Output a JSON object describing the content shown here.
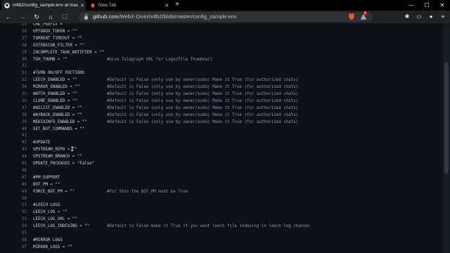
{
  "tabs": [
    {
      "title": "mltb2/config_sample.env at mas"
    },
    {
      "title": "New Tab"
    }
  ],
  "toolbar": {
    "url_host": "github.com",
    "url_path": "/WebX-Divin/mltb2/blob/master/config_sample.env",
    "badge_count": "4"
  },
  "icons": {
    "back": "back-arrow-icon",
    "forward": "forward-arrow-icon",
    "reload": "reload-icon",
    "home": "home-icon",
    "lock": "lock-icon",
    "brave": "brave-shield-icon",
    "rewards": "brave-rewards-icon",
    "extensions": "puzzle-icon",
    "profile": "profile-icon",
    "menu": "menu-icon"
  },
  "colors": {
    "background": "#0d1117",
    "code_text": "#c9d1d9",
    "line_number": "#6e7681",
    "comment": "#8b949e"
  },
  "code_lines": [
    {
      "n": "25",
      "code": "CMD_PREFIX = \"\"",
      "comment": ""
    },
    {
      "n": "26",
      "code": "UPTOBOX_TOKEN = \"\"",
      "comment": ""
    },
    {
      "n": "27",
      "code": "TORRENT_TIMEOUT = \"\"",
      "comment": ""
    },
    {
      "n": "28",
      "code": "EXTENSION_FILTER = \"\"",
      "comment": ""
    },
    {
      "n": "29",
      "code": "INCOMPLETE_TASK_NOTIFIER = \"\"",
      "comment": ""
    },
    {
      "n": "30",
      "code": "TGH_THUMB = \"\"",
      "comment": "#Give Telegraph URL for Logs/File Thumbnail"
    },
    {
      "n": "31",
      "code": "",
      "comment": ""
    },
    {
      "n": "32",
      "code": "#TURN ON/OFF FUCTIONS",
      "comment": ""
    },
    {
      "n": "33",
      "code": "LEECH_ENABLED = \"\"",
      "comment": "#Default is False (only use by owner/sudo) Make it True (for authorized chats)"
    },
    {
      "n": "34",
      "code": "MIRROR_ENABLED = \"\"",
      "comment": "#Default is False (only use by owner/sudo) Make it True (for authorized chats)"
    },
    {
      "n": "35",
      "code": "WATCH_ENABLED = \"\"",
      "comment": "#Default is False (only use by owner/sudo) Make it True (for authorized chats)"
    },
    {
      "n": "36",
      "code": "CLONE_ENABLED = \"\"",
      "comment": "#Default is False (only use by owner/sudo) Make it True (for authorized chats)"
    },
    {
      "n": "37",
      "code": "ANILIST_ENABLED = \"\"",
      "comment": "#Default is False (only use by owner/sudo) Make it True (for authorized chats)"
    },
    {
      "n": "38",
      "code": "WAYBACK_ENABLED = \"\"",
      "comment": "#Default is False (only use by owner/sudo) Make it True (for authorized chats)"
    },
    {
      "n": "39",
      "code": "MEDIAINFO_ENABLED = \"\"",
      "comment": "#Default is False (only use by owner/sudo) Make it True (for authorized chats)"
    },
    {
      "n": "40",
      "code": "SET_BOT_COMMANDS = \"\"",
      "comment": ""
    },
    {
      "n": "41",
      "code": "",
      "comment": ""
    },
    {
      "n": "42",
      "code": "#UPDATE",
      "comment": ""
    },
    {
      "n": "43",
      "code": "UPSTREAM_REPO = \"\"",
      "comment": ""
    },
    {
      "n": "44",
      "code": "UPSTREAM_BRANCH = \"\"",
      "comment": ""
    },
    {
      "n": "45",
      "code": "UPDATE_PACKAGES = \"False\"",
      "comment": ""
    },
    {
      "n": "46",
      "code": "",
      "comment": ""
    },
    {
      "n": "47",
      "code": "#PM SUPPORT",
      "comment": ""
    },
    {
      "n": "48",
      "code": "BOT_PM = \"\"",
      "comment": ""
    },
    {
      "n": "49",
      "code": "FORCE_BOT_PM = \"\"",
      "comment": "#For this the BOT_PM must be True"
    },
    {
      "n": "50",
      "code": "",
      "comment": ""
    },
    {
      "n": "51",
      "code": "#LEECH LOGS",
      "comment": ""
    },
    {
      "n": "52",
      "code": "LEECH_LOG = \"\"",
      "comment": ""
    },
    {
      "n": "53",
      "code": "LEECH_LOG_URL = \"\"",
      "comment": ""
    },
    {
      "n": "54",
      "code": "LEECH_LOG_INDEXING = \"\"",
      "comment": "#Default is False make it True if you want leech file indexing in leech log channel"
    },
    {
      "n": "55",
      "code": "",
      "comment": ""
    },
    {
      "n": "56",
      "code": "#MIRROR LOGS",
      "comment": ""
    },
    {
      "n": "57",
      "code": "MIRROR_LOGS = \"\"",
      "comment": ""
    }
  ]
}
